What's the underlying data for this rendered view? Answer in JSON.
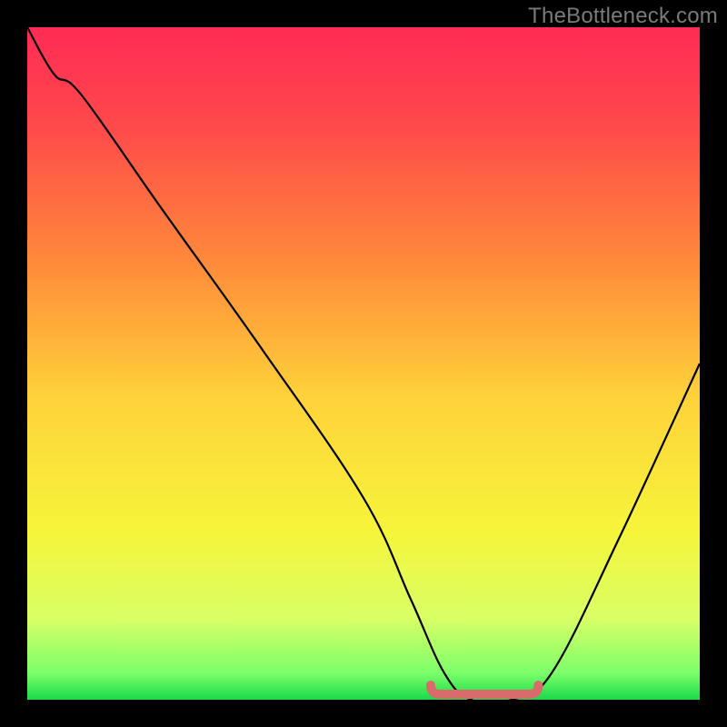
{
  "watermark": "TheBottleneck.com",
  "chart_data": {
    "type": "line",
    "title": "",
    "xlabel": "",
    "ylabel": "",
    "xlim": [
      0,
      100
    ],
    "ylim": [
      0,
      100
    ],
    "grid": false,
    "legend": false,
    "background_gradient": {
      "stops": [
        {
          "offset": 0.0,
          "color": "#ff2b55"
        },
        {
          "offset": 0.15,
          "color": "#ff4a4a"
        },
        {
          "offset": 0.35,
          "color": "#ff8a3a"
        },
        {
          "offset": 0.55,
          "color": "#ffd23a"
        },
        {
          "offset": 0.75,
          "color": "#f6f53a"
        },
        {
          "offset": 0.88,
          "color": "#d8ff66"
        },
        {
          "offset": 0.96,
          "color": "#7cff6a"
        },
        {
          "offset": 1.0,
          "color": "#1bd94a"
        }
      ]
    },
    "series": [
      {
        "name": "bottleneck-curve",
        "color": "#000000",
        "x": [
          0,
          4,
          8,
          20,
          35,
          50,
          57,
          62,
          66,
          72,
          78,
          88,
          100
        ],
        "y": [
          100,
          93,
          90,
          73,
          52,
          30,
          15,
          4,
          0,
          0,
          4,
          24,
          50
        ]
      }
    ],
    "highlight": {
      "name": "optimal-range",
      "color": "#d96b6b",
      "x_range": [
        60,
        76
      ],
      "y": 0
    }
  }
}
